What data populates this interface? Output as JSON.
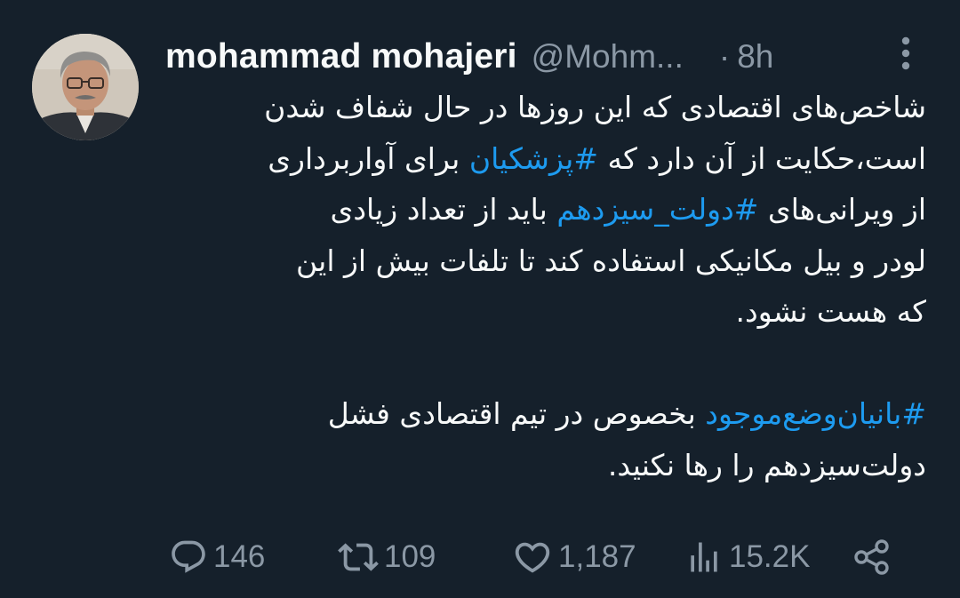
{
  "author": {
    "name": "mohammad mohajeri",
    "handle": "@Mohm...",
    "separator": "·",
    "time": "8h"
  },
  "tweet": {
    "paragraph1": [
      [
        {
          "text": "شاخص‌های اقتصادی که این روزها در حال شفاف شدن"
        }
      ],
      [
        {
          "text": "است،حکایت از آن دارد که "
        },
        {
          "text": "#پزشکیان",
          "hashtag": true
        },
        {
          "text": " برای آواربرداری"
        }
      ],
      [
        {
          "text": "از ویرانی‌های "
        },
        {
          "text": "#دولت_سیزدهم",
          "hashtag": true
        },
        {
          "text": " باید از تعداد زیادی"
        }
      ],
      [
        {
          "text": "لودر و بیل مکانیکی استفاده کند تا تلفات بیش از این"
        }
      ],
      [
        {
          "text": "که هست نشود."
        }
      ]
    ],
    "paragraph2": [
      [
        {
          "text": "#بانیان‌وضع‌موجود",
          "hashtag": true
        },
        {
          "text": " بخصوص در تیم اقتصادی فشل"
        }
      ],
      [
        {
          "text": "دولت‌سیزدهم را رها نکنید."
        }
      ]
    ]
  },
  "actions": {
    "reply_count": "146",
    "retweet_count": "109",
    "like_count": "1,187",
    "views_count": "15.2K"
  },
  "icons": {
    "more": "more-vertical-icon",
    "reply": "reply-icon",
    "retweet": "retweet-icon",
    "like": "heart-icon",
    "views": "views-icon",
    "share": "share-icon"
  },
  "colors": {
    "background": "#15202b",
    "text": "#f7f9f9",
    "muted": "#8b98a5",
    "accent": "#1d9bf0"
  }
}
